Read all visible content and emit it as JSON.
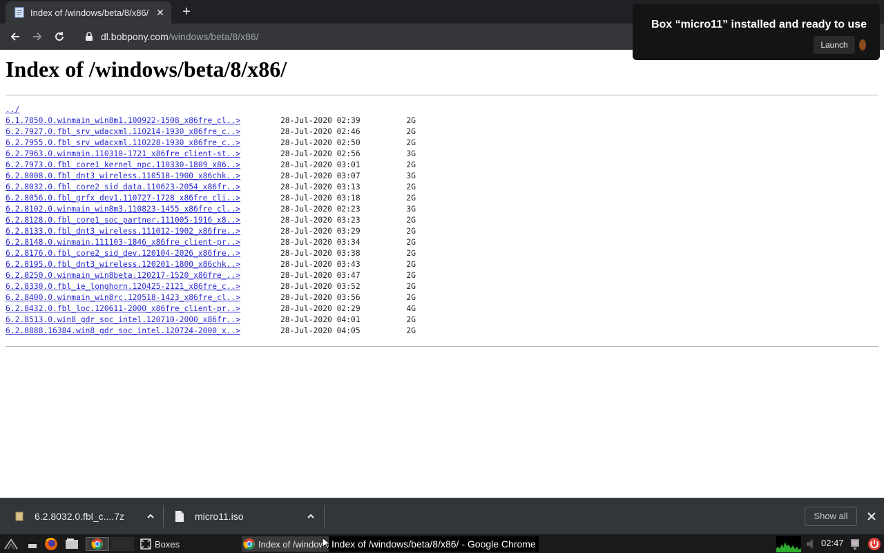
{
  "browser": {
    "tab": {
      "title": "Index of /windows/beta/8/x86/",
      "favicon": "page-icon"
    },
    "url": {
      "host": "dl.bobpony.com",
      "path": "/windows/beta/8/x86/"
    }
  },
  "page": {
    "heading": "Index of /windows/beta/8/x86/",
    "parent_link": "../",
    "files": [
      {
        "name": "6.1.7850.0.winmain_win8m1.100922-1508_x86fre_cl..>",
        "date": "28-Jul-2020 02:39",
        "size": "2G"
      },
      {
        "name": "6.2.7927.0.fbl_srv_wdacxml.110214-1930_x86fre_c..>",
        "date": "28-Jul-2020 02:46",
        "size": "2G"
      },
      {
        "name": "6.2.7955.0.fbl_srv_wdacxml.110228-1930_x86fre_c..>",
        "date": "28-Jul-2020 02:50",
        "size": "2G"
      },
      {
        "name": "6.2.7963.0.winmain.110310-1721_x86fre_client-st..>",
        "date": "28-Jul-2020 02:56",
        "size": "3G"
      },
      {
        "name": "6.2.7973.0.fbl_core1_kernel_npc.110330-1809_x86..>",
        "date": "28-Jul-2020 03:01",
        "size": "2G"
      },
      {
        "name": "6.2.8008.0.fbl_dnt3_wireless.110518-1900_x86chk..>",
        "date": "28-Jul-2020 03:07",
        "size": "3G"
      },
      {
        "name": "6.2.8032.0.fbl_core2_sid_data.110623-2054_x86fr..>",
        "date": "28-Jul-2020 03:13",
        "size": "2G"
      },
      {
        "name": "6.2.8056.0.fbl_grfx_dev1.110727-1728_x86fre_cli..>",
        "date": "28-Jul-2020 03:18",
        "size": "2G"
      },
      {
        "name": "6.2.8102.0.winmain_win8m3.110823-1455_x86fre_cl..>",
        "date": "28-Jul-2020 02:23",
        "size": "3G"
      },
      {
        "name": "6.2.8128.0.fbl_core1_soc_partner.111005-1916_x8..>",
        "date": "28-Jul-2020 03:23",
        "size": "2G"
      },
      {
        "name": "6.2.8133.0.fbl_dnt3_wireless.111012-1902_x86fre..>",
        "date": "28-Jul-2020 03:29",
        "size": "2G"
      },
      {
        "name": "6.2.8148.0.winmain.111103-1846_x86fre_client-pr..>",
        "date": "28-Jul-2020 03:34",
        "size": "2G"
      },
      {
        "name": "6.2.8176.0.fbl_core2_sid_dev.120104-2026_x86fre..>",
        "date": "28-Jul-2020 03:38",
        "size": "2G"
      },
      {
        "name": "6.2.8195.0.fbl_dnt3_wireless.120201-1800_x86chk..>",
        "date": "28-Jul-2020 03:43",
        "size": "2G"
      },
      {
        "name": "6.2.8250.0.winmain_win8beta.120217-1520_x86fre_..>",
        "date": "28-Jul-2020 03:47",
        "size": "2G"
      },
      {
        "name": "6.2.8330.0.fbl_ie_longhorn.120425-2121_x86fre_c..>",
        "date": "28-Jul-2020 03:52",
        "size": "2G"
      },
      {
        "name": "6.2.8400.0.winmain_win8rc.120518-1423_x86fre_cl..>",
        "date": "28-Jul-2020 03:56",
        "size": "2G"
      },
      {
        "name": "6.2.8432.0.fbl_loc.120611-2000_x86fre_client-pr..>",
        "date": "28-Jul-2020 02:29",
        "size": "4G"
      },
      {
        "name": "6.2.8513.0.win8_gdr_soc_intel.120710-2000_x86fr..>",
        "date": "28-Jul-2020 04:01",
        "size": "2G"
      },
      {
        "name": "6.2.8888.16384.win8_gdr_soc_intel.120724-2000_x..>",
        "date": "28-Jul-2020 04:05",
        "size": "2G"
      }
    ]
  },
  "notification": {
    "title": "Box “micro11” installed and ready to use",
    "button": "Launch"
  },
  "downloads": {
    "items": [
      {
        "name": "6.2.8032.0.fbl_c....7z",
        "icon": "archive-icon"
      },
      {
        "name": "micro11.iso",
        "icon": "file-icon"
      }
    ],
    "show_all": "Show all"
  },
  "taskbar": {
    "tasks": [
      {
        "label": "Boxes",
        "icon": "boxes-icon"
      },
      {
        "label": "Index of /windows/beta/8/x86/ - Google Chrome",
        "icon": "chrome-icon"
      }
    ],
    "tooltip": "Index of /windows/beta/8/x86/ - Google Chrome",
    "clock": "02:47"
  },
  "colors": {
    "link": "#2a2ad0",
    "chrome_dark": "#35363a",
    "download_bar": "#323639",
    "power_button": "#e0443a"
  }
}
